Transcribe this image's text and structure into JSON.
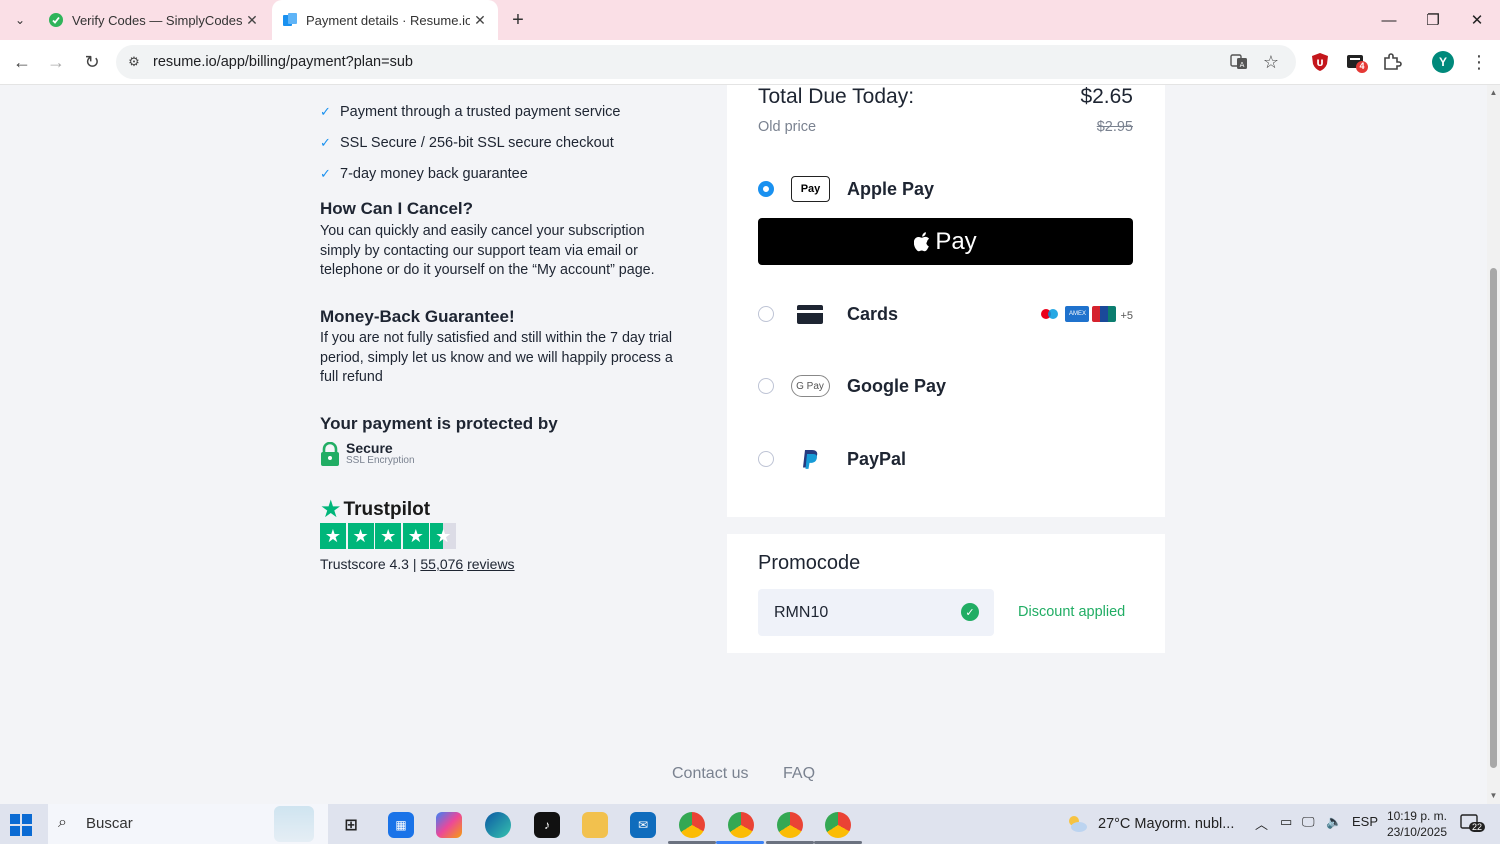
{
  "browser": {
    "tabs": [
      {
        "title": "Verify Codes — SimplyCodes",
        "active": false
      },
      {
        "title": "Payment details · Resume.io",
        "active": true
      }
    ],
    "url": "resume.io/app/billing/payment?plan=sub",
    "extension_badge": "4",
    "profile_initial": "Y"
  },
  "features": [
    "Payment through a trusted payment service",
    "SSL Secure / 256-bit SSL secure checkout",
    "7-day money back guarantee"
  ],
  "cancel": {
    "heading": "How Can I Cancel?",
    "body": "You can quickly and easily cancel your subscription simply by contacting our support team via email or telephone or do it yourself on the “My account” page."
  },
  "guarantee": {
    "heading": "Money-Back Guarantee!",
    "body": "If you are not fully satisfied and still within the 7 day trial period, simply let us know and we will happily process a full refund"
  },
  "protection": {
    "heading": "Your payment is protected by",
    "secure_title": "Secure",
    "secure_sub": "SSL Encryption"
  },
  "trustpilot": {
    "brand": "Trustpilot",
    "rating": 4.5,
    "score_prefix": "Trustscore 4.3 |",
    "reviews_count": "55,076",
    "reviews_label": "reviews"
  },
  "payment": {
    "total_label": "Total Due Today:",
    "total_value": "$2.65",
    "old_label": "Old price",
    "old_value": "$2.95",
    "methods": [
      {
        "label": "Apple Pay",
        "icon": "apple-pay-icon",
        "selected": true
      },
      {
        "label": "Cards",
        "icon": "credit-card-icon",
        "selected": false
      },
      {
        "label": "Google Pay",
        "icon": "google-pay-icon",
        "selected": false
      },
      {
        "label": "PayPal",
        "icon": "paypal-icon",
        "selected": false
      }
    ],
    "apple_badge": "Pay",
    "apple_button": "Pay",
    "cards_more": "+5",
    "gpay_badge": "G Pay"
  },
  "promo": {
    "title": "Promocode",
    "value": "RMN10",
    "status": "Discount applied"
  },
  "footer": {
    "contact": "Contact us",
    "faq": "FAQ"
  },
  "taskbar": {
    "search_placeholder": "Buscar",
    "weather": "27°C  Mayorm. nubl...",
    "language": "ESP",
    "time": "10:19 p. m.",
    "date": "23/10/2025",
    "notifications": "22"
  },
  "colors": {
    "accent": "#1a91f0",
    "success": "#21ad64",
    "trustpilot": "#00b67a",
    "tabbar": "#fadfe6"
  }
}
